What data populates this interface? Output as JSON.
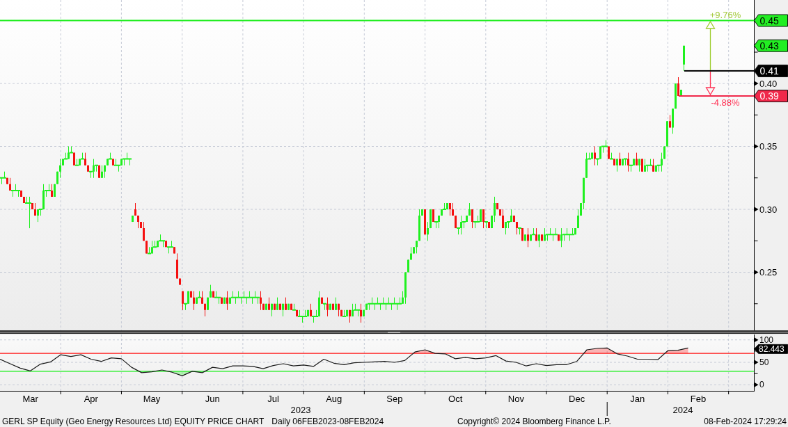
{
  "price_panel": {
    "axis_ticks": [
      "0.40",
      "0.35",
      "0.30",
      "0.25"
    ],
    "tags": [
      {
        "label": "0.45",
        "color": "#22ee22",
        "line": true
      },
      {
        "label": "0.43",
        "color": "#22ee22",
        "line": false
      },
      {
        "label": "0.41",
        "color": "#000000",
        "line": true
      },
      {
        "label": "0.39",
        "color": "#f0284a",
        "line": true
      }
    ],
    "change_up": "+9.76%",
    "change_down": "-4.88%"
  },
  "rsi_panel": {
    "tag": "82.443",
    "chart_data": {
      "type": "line",
      "categories": [
        null,
        null,
        null,
        "Mar",
        null,
        null,
        null,
        null,
        null,
        "Apr",
        null,
        null,
        null,
        null,
        null,
        "May",
        null,
        null,
        null,
        null,
        null,
        "Jun",
        null,
        null,
        null,
        null,
        null,
        "Jul",
        null,
        null,
        null,
        null,
        null,
        "Aug",
        null,
        null,
        null,
        null,
        null,
        "Sep",
        null,
        null,
        null,
        null,
        null,
        "Oct",
        null,
        null,
        null,
        null,
        null,
        "Nov",
        null,
        null,
        null,
        null,
        null,
        "Dec",
        null,
        null,
        null,
        null,
        null,
        "Jan",
        null,
        null,
        null,
        null,
        null,
        "Feb",
        null,
        null,
        null,
        null,
        null
      ],
      "series": [
        {
          "color": "#1a1a1a",
          "values": [
            57,
            47,
            37,
            31,
            46,
            51,
            67,
            63,
            67,
            57,
            52,
            60,
            58,
            39,
            27,
            29,
            33,
            28,
            20,
            30,
            27,
            39,
            36,
            42,
            42,
            41,
            36,
            43,
            47,
            42,
            44,
            41,
            57,
            48,
            45,
            49,
            50,
            51,
            52,
            50,
            54,
            73,
            78,
            70,
            69,
            58,
            61,
            58,
            60,
            65,
            53,
            50,
            42,
            47,
            43,
            45,
            45,
            52,
            78,
            81,
            82,
            69,
            64,
            57,
            57,
            56,
            76,
            77,
            82,
            null,
            null,
            null,
            null,
            null,
            null
          ]
        }
      ],
      "ylim": [
        -15,
        112
      ],
      "yticks": [
        100,
        50,
        0
      ],
      "grid": true,
      "ref_lines": [
        {
          "axis": "y",
          "value": 70,
          "color": "#ff1a1a"
        },
        {
          "axis": "y",
          "value": 30,
          "color": "#22ee22"
        }
      ]
    }
  },
  "x_axis": {
    "years": [
      "2023",
      "2024"
    ]
  },
  "footer": {
    "title": "GERL SP Equity (Geo Energy Resources Ltd) EQUITY PRICE CHART",
    "period": "Daily 06FEB2023-08FEB2024",
    "copyright": "Copyright© 2024 Bloomberg Finance L.P.",
    "timestamp": "08-Feb-2024 17:29:24"
  }
}
